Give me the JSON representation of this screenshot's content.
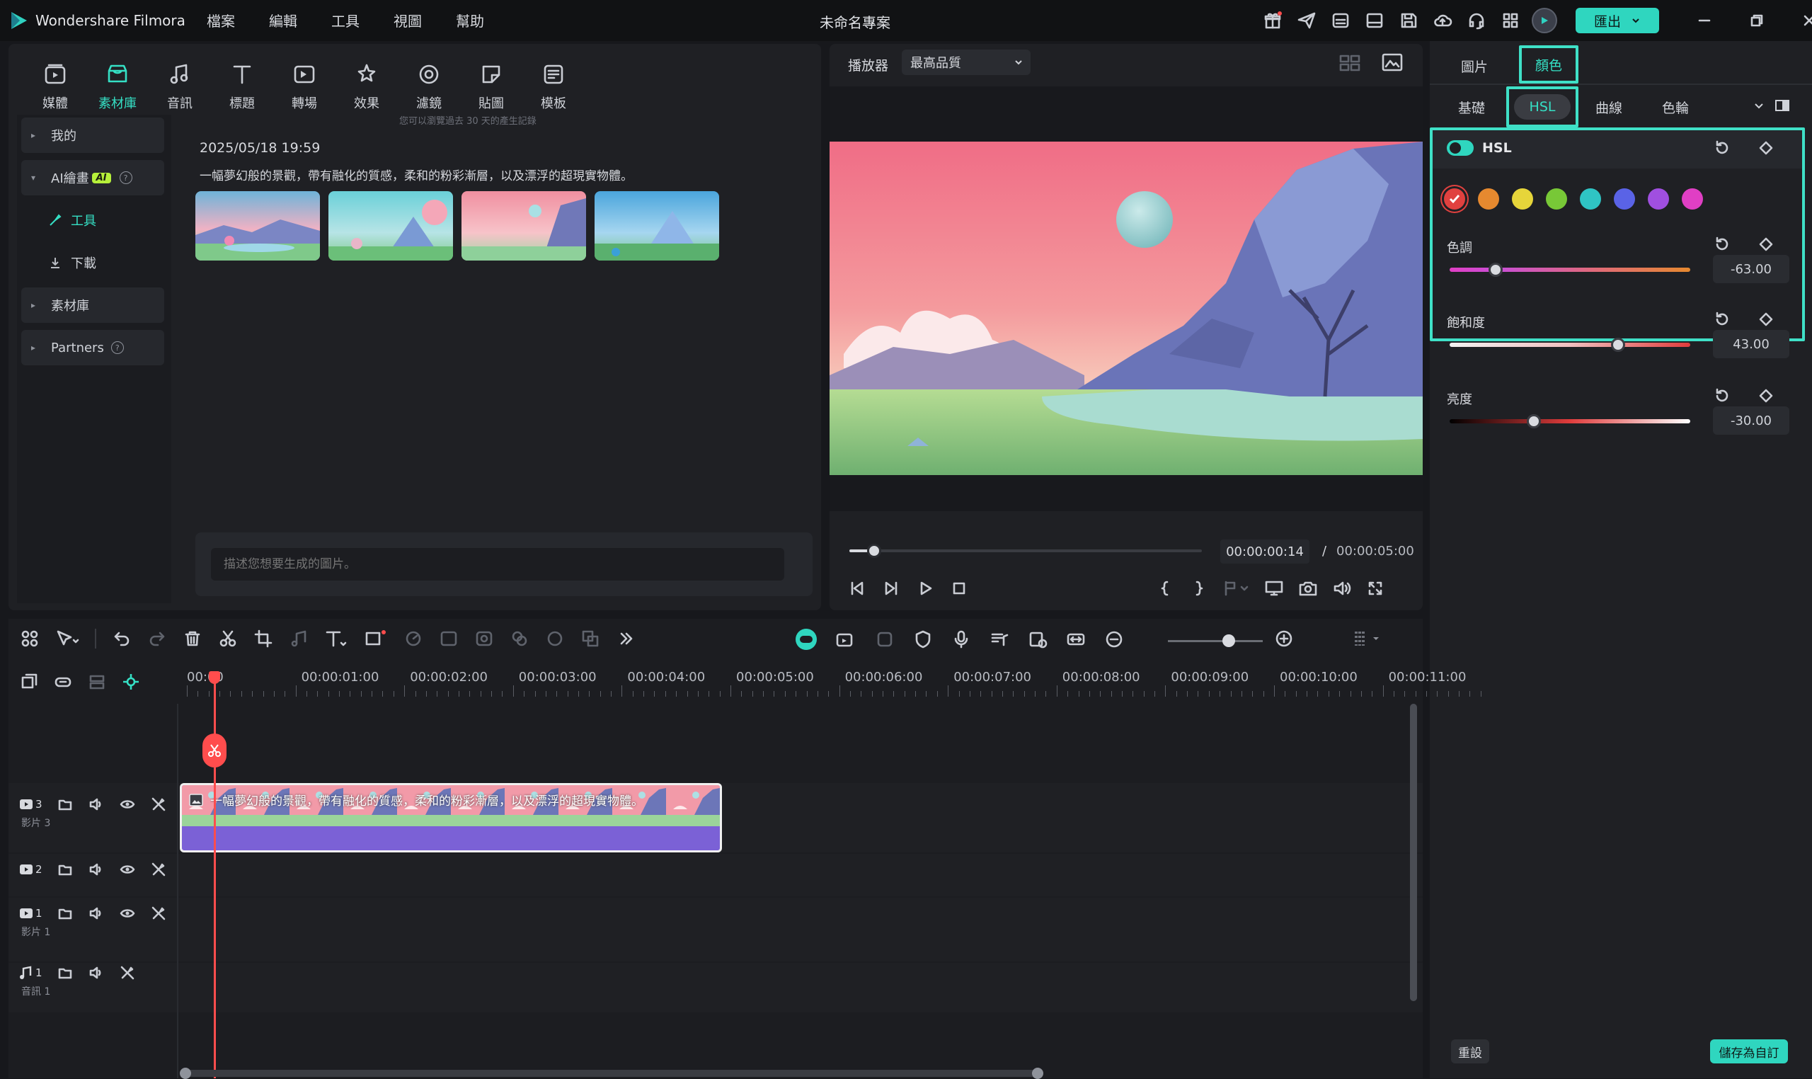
{
  "app": {
    "name": "Wondershare Filmora",
    "project_title": "未命名專案",
    "export_label": "匯出"
  },
  "menu": [
    "檔案",
    "編輯",
    "工具",
    "視圖",
    "幫助"
  ],
  "library": {
    "tabs": [
      {
        "label": "媒體",
        "icon": "media-icon"
      },
      {
        "label": "素材庫",
        "icon": "stock-library-icon"
      },
      {
        "label": "音訊",
        "icon": "audio-icon"
      },
      {
        "label": "標題",
        "icon": "title-icon"
      },
      {
        "label": "轉場",
        "icon": "transition-icon"
      },
      {
        "label": "效果",
        "icon": "effects-icon"
      },
      {
        "label": "濾鏡",
        "icon": "filter-icon"
      },
      {
        "label": "貼圖",
        "icon": "sticker-icon"
      },
      {
        "label": "模板",
        "icon": "template-icon"
      }
    ],
    "active_tab": "素材庫",
    "sidebar": {
      "mine": "我的",
      "ai_image": "AI繪畫",
      "ai_badge": "AI",
      "tools": "工具",
      "download": "下載",
      "stock": "素材庫",
      "partners": "Partners"
    },
    "history_note": "您可以瀏覽過去 30 天的產生記錄",
    "entry_date": "2025/05/18 19:59",
    "entry_prompt": "一幅夢幻般的景觀，帶有融化的質感，柔和的粉彩漸層，以及漂浮的超現實物體。",
    "prompt_placeholder": "描述您想要生成的圖片。"
  },
  "player": {
    "label": "播放器",
    "quality": "最高品質",
    "current_time": "00:00:00:14",
    "separator": "/",
    "total_time": "00:00:05:00",
    "progress_fraction": 0.07
  },
  "color_panel": {
    "tabs": [
      "圖片",
      "顏色"
    ],
    "active_tab": "顏色",
    "subtabs": [
      "基礎",
      "HSL",
      "曲線",
      "色輪"
    ],
    "active_subtab": "HSL",
    "section_title": "HSL",
    "swatches": [
      "#e0413f",
      "#e6892f",
      "#e6d53a",
      "#78c837",
      "#2fc4c4",
      "#5a63e6",
      "#a04fe0",
      "#e03fc4"
    ],
    "selected_swatch": 0,
    "sliders": [
      {
        "label": "色調",
        "value": "-63.00",
        "fraction": 0.19,
        "track": "linear-gradient(90deg,#e03fc4,#c94fd6 20%,#e06a7a 60%,#e6892f)"
      },
      {
        "label": "飽和度",
        "value": "43.00",
        "fraction": 0.7,
        "track": "linear-gradient(90deg,#f2f2f2,#f0c0c0 50%,#e03c3c)"
      },
      {
        "label": "亮度",
        "value": "-30.00",
        "fraction": 0.35,
        "track": "linear-gradient(90deg,#000,#e03c3c 50%,#fff)"
      }
    ],
    "reset_label": "重設",
    "save_label": "儲存為自訂"
  },
  "timeline": {
    "ruler": [
      "00:00",
      "00:00:01:00",
      "00:00:02:00",
      "00:00:03:00",
      "00:00:04:00",
      "00:00:05:00",
      "00:00:06:00",
      "00:00:07:00",
      "00:00:08:00",
      "00:00:09:00",
      "00:00:10:00",
      "00:00:11:00"
    ],
    "tracks": [
      {
        "num": "3",
        "name": "影片 3"
      },
      {
        "num": "2",
        "name": ""
      },
      {
        "num": "1",
        "name": "影片 1"
      },
      {
        "num": "1",
        "name": "音訊 1"
      }
    ],
    "clip_title": "一幅夢幻般的景觀，帶有融化的質感，柔和的粉彩漸層，以及漂浮的超現實物體。"
  }
}
